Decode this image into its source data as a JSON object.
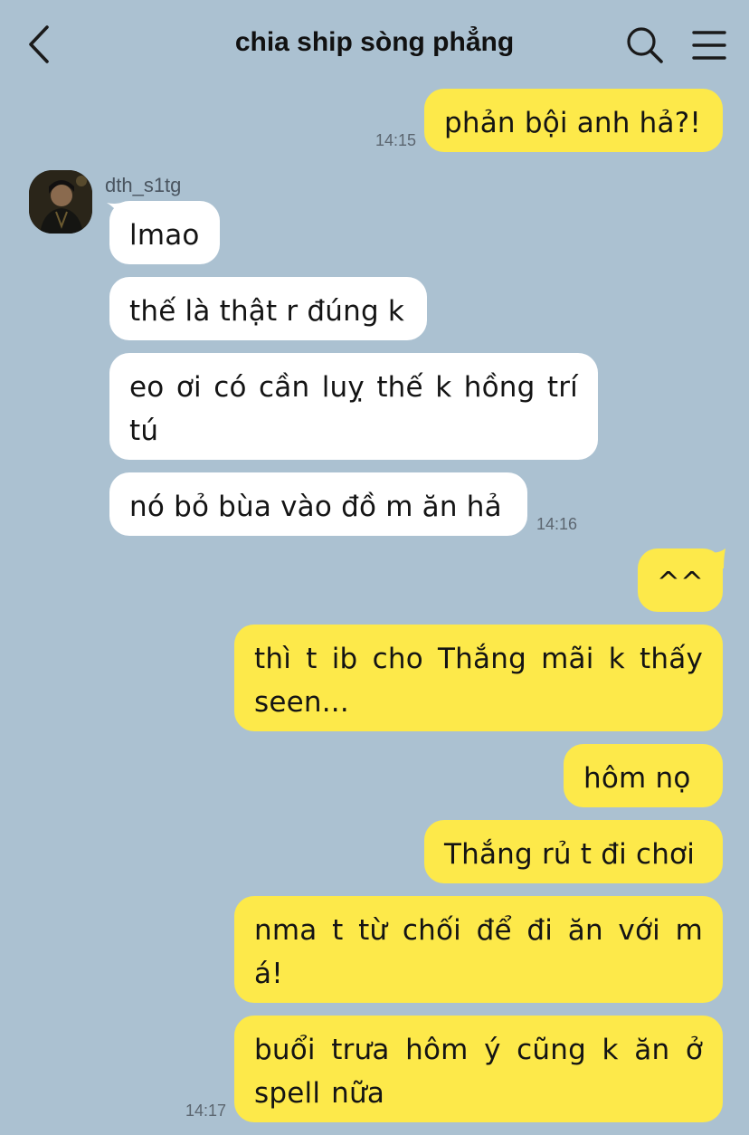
{
  "header": {
    "title": "chia ship sòng phẳng",
    "back_icon": "chevron-left-icon",
    "search_icon": "search-icon",
    "menu_icon": "hamburger-menu-icon"
  },
  "colors": {
    "background": "#abc1d1",
    "incoming_bubble": "#ffffff",
    "outgoing_bubble": "#fde94a"
  },
  "sender": {
    "name": "dth_s1tg"
  },
  "messages": [
    {
      "dir": "out",
      "text": "phản bội anh hả?!",
      "time": "14:15"
    },
    {
      "dir": "in",
      "text": "lmao"
    },
    {
      "dir": "in",
      "text": "thế là thật r đúng k"
    },
    {
      "dir": "in",
      "text": "eo ơi có cần luỵ thế k hồng trí tú"
    },
    {
      "dir": "in",
      "text": "nó bỏ bùa vào đồ m ăn hả",
      "time": "14:16"
    },
    {
      "dir": "out",
      "text": "^^"
    },
    {
      "dir": "out",
      "text": "thì t ib cho Thắng mãi k thấy seen..."
    },
    {
      "dir": "out",
      "text": "hôm nọ"
    },
    {
      "dir": "out",
      "text": "Thắng rủ t đi chơi"
    },
    {
      "dir": "out",
      "text": "nma t từ chối để đi ăn với m á!"
    },
    {
      "dir": "out",
      "text": "buổi trưa hôm ý cũng k ăn ở spell nữa",
      "time": "14:17"
    }
  ]
}
